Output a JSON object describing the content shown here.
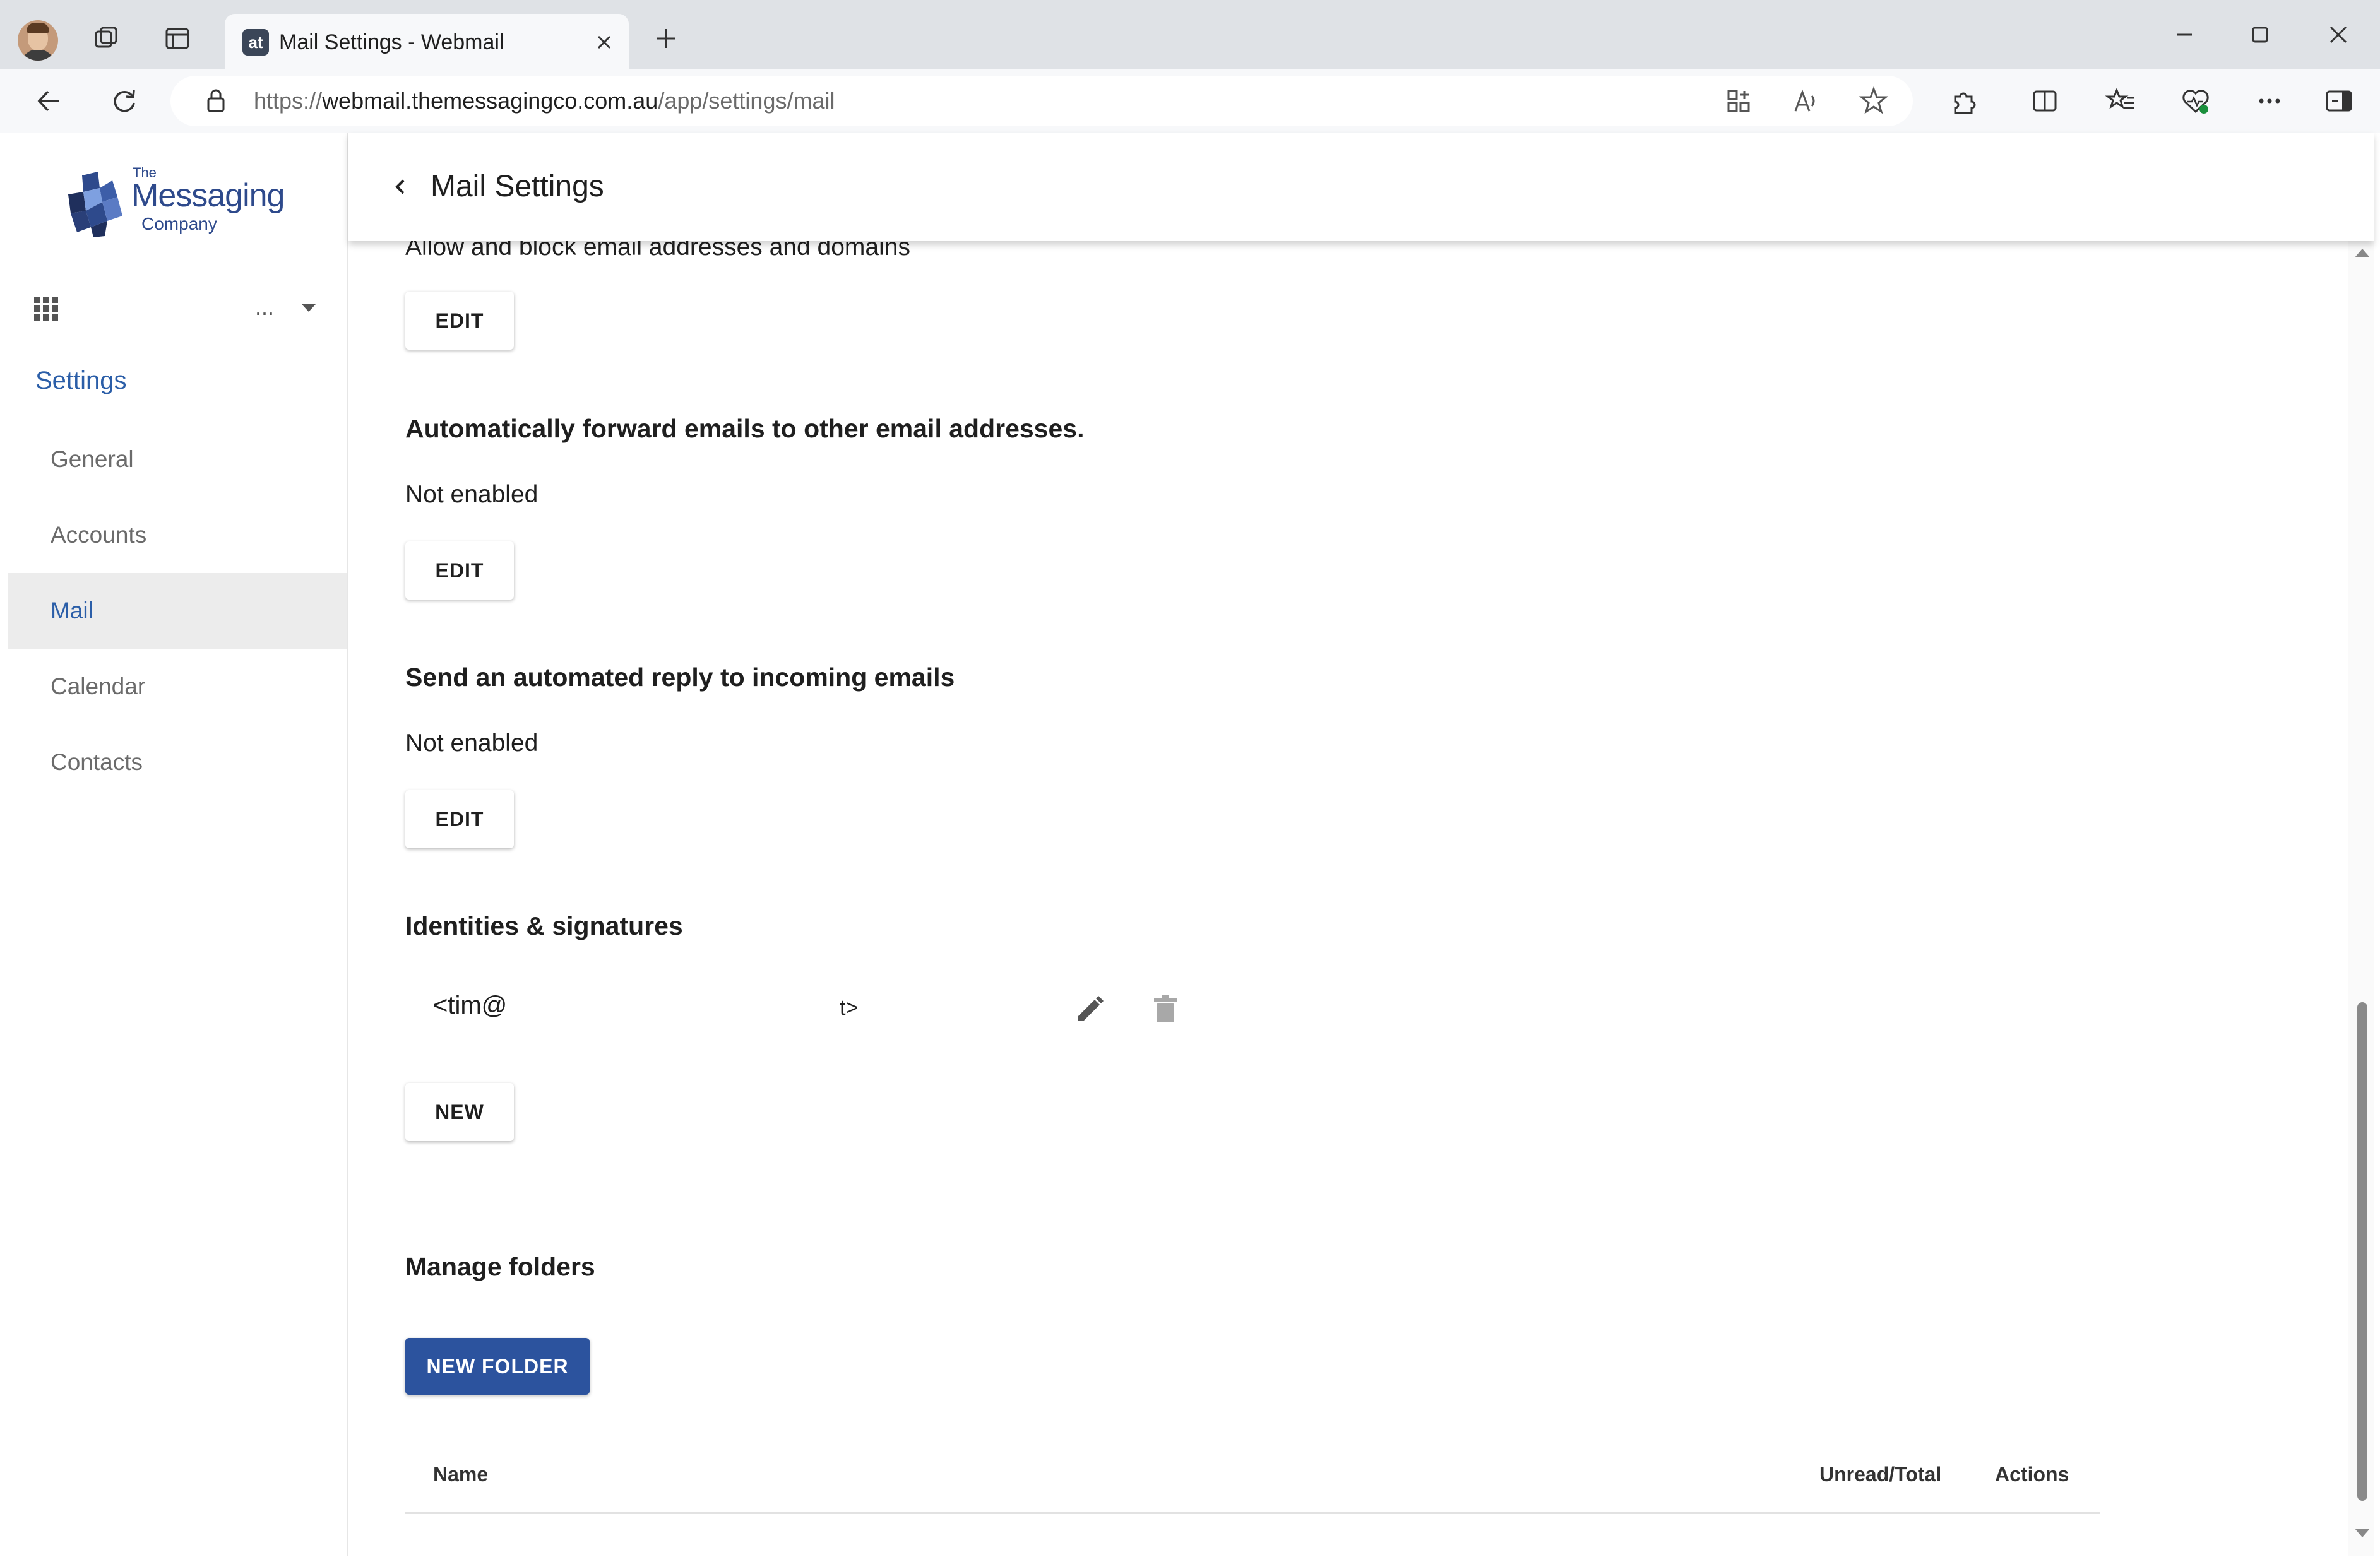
{
  "browser": {
    "tab_title": "Mail Settings - Webmail",
    "tab_favicon": "at",
    "url_prefix": "https://",
    "url_host": "webmail.themessagingco.com.au",
    "url_path": "/app/settings/mail"
  },
  "logo": {
    "line1": "The",
    "line2": "Messaging",
    "line3": "Company"
  },
  "sidebar": {
    "account_label": "...",
    "settings_heading": "Settings",
    "items": [
      {
        "label": "General",
        "active": false
      },
      {
        "label": "Accounts",
        "active": false
      },
      {
        "label": "Mail",
        "active": true
      },
      {
        "label": "Calendar",
        "active": false
      },
      {
        "label": "Contacts",
        "active": false
      }
    ]
  },
  "header": {
    "title": "Mail Settings"
  },
  "sections": {
    "block": {
      "text": "Allow and block email addresses and domains",
      "button": "EDIT"
    },
    "forward": {
      "title": "Automatically forward emails to other email addresses.",
      "status": "Not enabled",
      "button": "EDIT"
    },
    "autoreply": {
      "title": "Send an automated reply to incoming emails",
      "status": "Not enabled",
      "button": "EDIT"
    },
    "identities": {
      "title": "Identities & signatures",
      "entry_start": "<tim@",
      "entry_end": "t>",
      "button": "NEW"
    },
    "folders": {
      "title": "Manage folders",
      "button": "NEW FOLDER",
      "columns": [
        "Name",
        "Unread/Total",
        "Actions"
      ]
    }
  },
  "icons": {
    "back": "chevron-left-icon",
    "apps": "grid-icon",
    "dropdown": "caret-down-icon",
    "edit": "pencil-icon",
    "delete": "trash-icon"
  },
  "colors": {
    "accent": "#2b5ea8",
    "primary_button": "#2c539e",
    "active_nav_bg": "#ececec"
  }
}
